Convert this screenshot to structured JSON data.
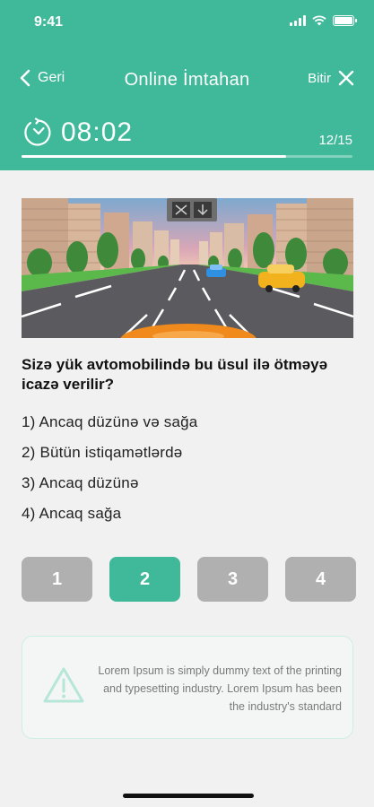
{
  "status": {
    "time": "9:41"
  },
  "nav": {
    "back_label": "Geri",
    "title": "Online İmtahan",
    "finish_label": "Bitir"
  },
  "timer": {
    "value": "08:02"
  },
  "progress": {
    "label": "12/15",
    "current": 12,
    "total": 15
  },
  "question": {
    "text": "Sizə yük avtomobilində bu üsul ilə ötməyə icazə verilir?"
  },
  "answers": [
    {
      "label": "1)  Ancaq düzünə və sağa"
    },
    {
      "label": "2)  Bütün istiqamətlərdə"
    },
    {
      "label": "3)  Ancaq düzünə"
    },
    {
      "label": "4) Ancaq sağa"
    }
  ],
  "choices": [
    {
      "label": "1",
      "selected": false
    },
    {
      "label": "2",
      "selected": true
    },
    {
      "label": "3",
      "selected": false
    },
    {
      "label": "4",
      "selected": false
    }
  ],
  "info": {
    "icon": "warning-icon",
    "text": "Lorem Ipsum is simply dummy text of the printing and typesetting industry. Lorem Ipsum has been the industry's standard"
  },
  "colors": {
    "accent": "#3fb99a",
    "inactive_choice": "#b0b0b0",
    "background": "#f1f1f1"
  }
}
